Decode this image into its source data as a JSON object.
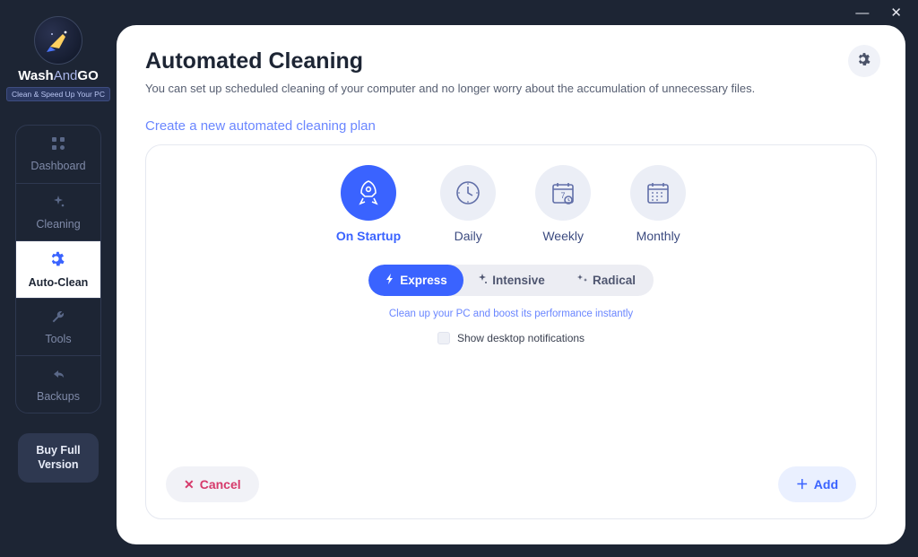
{
  "app": {
    "name_wash": "Wash",
    "name_and": "And",
    "name_go": "GO",
    "tagline": "Clean & Speed Up Your PC"
  },
  "sidebar": {
    "items": [
      {
        "label": "Dashboard"
      },
      {
        "label": "Cleaning"
      },
      {
        "label": "Auto-Clean"
      },
      {
        "label": "Tools"
      },
      {
        "label": "Backups"
      }
    ],
    "buy": "Buy Full Version"
  },
  "page": {
    "title": "Automated Cleaning",
    "subtitle": "You can set up scheduled cleaning of your computer and no longer worry about the accumulation of unnecessary files.",
    "section": "Create a new automated cleaning plan"
  },
  "freq": {
    "startup": "On Startup",
    "daily": "Daily",
    "weekly": "Weekly",
    "monthly": "Monthly"
  },
  "modes": {
    "express": "Express",
    "intensive": "Intensive",
    "radical": "Radical"
  },
  "hint": "Clean up your PC and boost its performance instantly",
  "notif_label": "Show desktop notifications",
  "buttons": {
    "cancel": "Cancel",
    "add": "Add"
  }
}
